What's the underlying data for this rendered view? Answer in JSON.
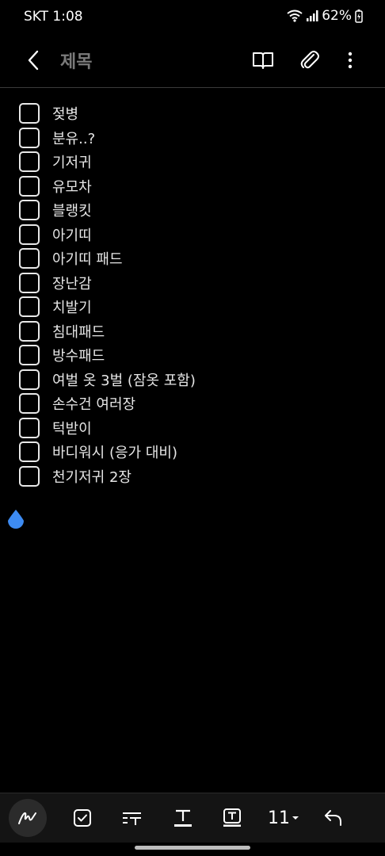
{
  "status_bar": {
    "carrier_time": "SKT 1:08",
    "battery": "62%"
  },
  "app_bar": {
    "title": "제목"
  },
  "checklist": {
    "items": [
      {
        "label": "젖병",
        "checked": false
      },
      {
        "label": "분유..?",
        "checked": false
      },
      {
        "label": "기저귀",
        "checked": false
      },
      {
        "label": "유모차",
        "checked": false
      },
      {
        "label": "블랭킷",
        "checked": false
      },
      {
        "label": "아기띠",
        "checked": false
      },
      {
        "label": "아기띠 패드",
        "checked": false
      },
      {
        "label": "장난감",
        "checked": false
      },
      {
        "label": "치발기",
        "checked": false
      },
      {
        "label": "침대패드",
        "checked": false
      },
      {
        "label": "방수패드",
        "checked": false
      },
      {
        "label": "여벌 옷 3벌 (잠옷 포함)",
        "checked": false
      },
      {
        "label": "손수건 여러장",
        "checked": false
      },
      {
        "label": "턱받이",
        "checked": false
      },
      {
        "label": "바디워시 (응가 대비)",
        "checked": false
      },
      {
        "label": "천기저귀 2장",
        "checked": false
      }
    ]
  },
  "toolbar": {
    "font_size": "11",
    "icons": [
      "pen-icon",
      "checkbox-icon",
      "text-format-icon",
      "text-color-icon",
      "text-background-icon",
      "font-size-dropdown",
      "undo-icon"
    ]
  },
  "colors": {
    "background": "#000000",
    "checkbox_border": "#e8e8e8",
    "cursor_handle": "#3d8bf2",
    "title_gray": "#7a7a7a"
  }
}
